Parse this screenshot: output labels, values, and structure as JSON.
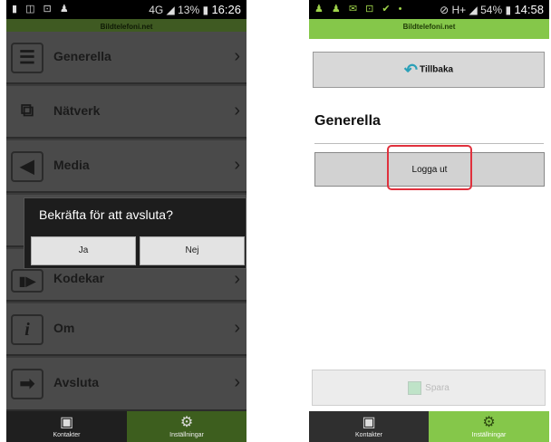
{
  "left": {
    "status": {
      "icons": "▮ ◫ ⊡ ♟",
      "network": "4G",
      "battery": "13%",
      "time": "16:26"
    },
    "app_title": "Bildtelefoni.net",
    "menu": [
      {
        "label": "Generella",
        "icon": "menu-icon"
      },
      {
        "label": "Nätverk",
        "icon": "network-icon"
      },
      {
        "label": "Media",
        "icon": "media-icon"
      },
      {
        "label": "",
        "icon": ""
      },
      {
        "label": "Kodekar",
        "icon": "codec-icon"
      },
      {
        "label": "Om",
        "icon": "info-icon"
      },
      {
        "label": "Avsluta",
        "icon": "exit-icon"
      }
    ],
    "dialog": {
      "message": "Bekräfta för att avsluta?",
      "yes": "Ja",
      "no": "Nej"
    },
    "tabs": [
      {
        "label": "Kontakter"
      },
      {
        "label": "Inställningar"
      }
    ]
  },
  "right": {
    "status": {
      "icons": "♟ ♟ ✉ ⊡ ✔ •",
      "signal": "H+",
      "battery": "54%",
      "time": "14:58"
    },
    "app_title": "Bildtelefoni.net",
    "back_label": "Tillbaka",
    "section_title": "Generella",
    "logout_label": "Logga ut",
    "save_label": "Spara",
    "tabs": [
      {
        "label": "Kontakter"
      },
      {
        "label": "Inställningar"
      }
    ]
  },
  "colors": {
    "accent": "#85c74a",
    "highlight": "#e0313d",
    "dark_tab": "#2f2f2f"
  }
}
